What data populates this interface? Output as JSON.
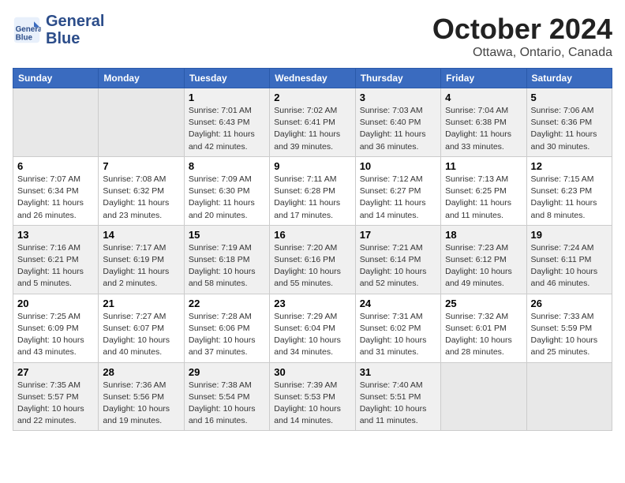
{
  "header": {
    "logo_line1": "General",
    "logo_line2": "Blue",
    "month": "October 2024",
    "location": "Ottawa, Ontario, Canada"
  },
  "weekdays": [
    "Sunday",
    "Monday",
    "Tuesday",
    "Wednesday",
    "Thursday",
    "Friday",
    "Saturday"
  ],
  "weeks": [
    [
      {
        "num": "",
        "info": ""
      },
      {
        "num": "",
        "info": ""
      },
      {
        "num": "1",
        "info": "Sunrise: 7:01 AM\nSunset: 6:43 PM\nDaylight: 11 hours and 42 minutes."
      },
      {
        "num": "2",
        "info": "Sunrise: 7:02 AM\nSunset: 6:41 PM\nDaylight: 11 hours and 39 minutes."
      },
      {
        "num": "3",
        "info": "Sunrise: 7:03 AM\nSunset: 6:40 PM\nDaylight: 11 hours and 36 minutes."
      },
      {
        "num": "4",
        "info": "Sunrise: 7:04 AM\nSunset: 6:38 PM\nDaylight: 11 hours and 33 minutes."
      },
      {
        "num": "5",
        "info": "Sunrise: 7:06 AM\nSunset: 6:36 PM\nDaylight: 11 hours and 30 minutes."
      }
    ],
    [
      {
        "num": "6",
        "info": "Sunrise: 7:07 AM\nSunset: 6:34 PM\nDaylight: 11 hours and 26 minutes."
      },
      {
        "num": "7",
        "info": "Sunrise: 7:08 AM\nSunset: 6:32 PM\nDaylight: 11 hours and 23 minutes."
      },
      {
        "num": "8",
        "info": "Sunrise: 7:09 AM\nSunset: 6:30 PM\nDaylight: 11 hours and 20 minutes."
      },
      {
        "num": "9",
        "info": "Sunrise: 7:11 AM\nSunset: 6:28 PM\nDaylight: 11 hours and 17 minutes."
      },
      {
        "num": "10",
        "info": "Sunrise: 7:12 AM\nSunset: 6:27 PM\nDaylight: 11 hours and 14 minutes."
      },
      {
        "num": "11",
        "info": "Sunrise: 7:13 AM\nSunset: 6:25 PM\nDaylight: 11 hours and 11 minutes."
      },
      {
        "num": "12",
        "info": "Sunrise: 7:15 AM\nSunset: 6:23 PM\nDaylight: 11 hours and 8 minutes."
      }
    ],
    [
      {
        "num": "13",
        "info": "Sunrise: 7:16 AM\nSunset: 6:21 PM\nDaylight: 11 hours and 5 minutes."
      },
      {
        "num": "14",
        "info": "Sunrise: 7:17 AM\nSunset: 6:19 PM\nDaylight: 11 hours and 2 minutes."
      },
      {
        "num": "15",
        "info": "Sunrise: 7:19 AM\nSunset: 6:18 PM\nDaylight: 10 hours and 58 minutes."
      },
      {
        "num": "16",
        "info": "Sunrise: 7:20 AM\nSunset: 6:16 PM\nDaylight: 10 hours and 55 minutes."
      },
      {
        "num": "17",
        "info": "Sunrise: 7:21 AM\nSunset: 6:14 PM\nDaylight: 10 hours and 52 minutes."
      },
      {
        "num": "18",
        "info": "Sunrise: 7:23 AM\nSunset: 6:12 PM\nDaylight: 10 hours and 49 minutes."
      },
      {
        "num": "19",
        "info": "Sunrise: 7:24 AM\nSunset: 6:11 PM\nDaylight: 10 hours and 46 minutes."
      }
    ],
    [
      {
        "num": "20",
        "info": "Sunrise: 7:25 AM\nSunset: 6:09 PM\nDaylight: 10 hours and 43 minutes."
      },
      {
        "num": "21",
        "info": "Sunrise: 7:27 AM\nSunset: 6:07 PM\nDaylight: 10 hours and 40 minutes."
      },
      {
        "num": "22",
        "info": "Sunrise: 7:28 AM\nSunset: 6:06 PM\nDaylight: 10 hours and 37 minutes."
      },
      {
        "num": "23",
        "info": "Sunrise: 7:29 AM\nSunset: 6:04 PM\nDaylight: 10 hours and 34 minutes."
      },
      {
        "num": "24",
        "info": "Sunrise: 7:31 AM\nSunset: 6:02 PM\nDaylight: 10 hours and 31 minutes."
      },
      {
        "num": "25",
        "info": "Sunrise: 7:32 AM\nSunset: 6:01 PM\nDaylight: 10 hours and 28 minutes."
      },
      {
        "num": "26",
        "info": "Sunrise: 7:33 AM\nSunset: 5:59 PM\nDaylight: 10 hours and 25 minutes."
      }
    ],
    [
      {
        "num": "27",
        "info": "Sunrise: 7:35 AM\nSunset: 5:57 PM\nDaylight: 10 hours and 22 minutes."
      },
      {
        "num": "28",
        "info": "Sunrise: 7:36 AM\nSunset: 5:56 PM\nDaylight: 10 hours and 19 minutes."
      },
      {
        "num": "29",
        "info": "Sunrise: 7:38 AM\nSunset: 5:54 PM\nDaylight: 10 hours and 16 minutes."
      },
      {
        "num": "30",
        "info": "Sunrise: 7:39 AM\nSunset: 5:53 PM\nDaylight: 10 hours and 14 minutes."
      },
      {
        "num": "31",
        "info": "Sunrise: 7:40 AM\nSunset: 5:51 PM\nDaylight: 10 hours and 11 minutes."
      },
      {
        "num": "",
        "info": ""
      },
      {
        "num": "",
        "info": ""
      }
    ]
  ]
}
